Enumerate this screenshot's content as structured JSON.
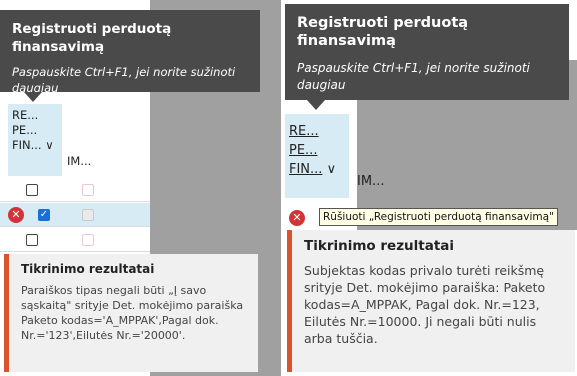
{
  "left_panel": {
    "tooltip_title": "Registruoti perduotą finansavimą",
    "tooltip_hint": "Paspauskite Ctrl+F1, jei norite sužinoti daugiau",
    "column_header_lines": [
      "RE...",
      "PE...",
      "FIN..."
    ],
    "column_header_chevron": "∨",
    "column2_header": "IM...",
    "check_mark": "✓",
    "error_icon_glyph": "✕",
    "result_title": "Tikrinimo rezultatai",
    "result_text": "Paraiškos tipas negali būti „Į savo sąskaitą\" srityje Det. mokėjimo paraiška Paketo kodas='A_MPPAK',Pagal dok. Nr.='123',Eilutės Nr.='20000'."
  },
  "right_panel": {
    "tooltip_title": "Registruoti perduotą finansavimą",
    "tooltip_hint": "Paspauskite Ctrl+F1, jei norite sužinoti daugiau",
    "column_header_lines": [
      "RE...",
      "PE...",
      "FIN..."
    ],
    "column_header_chevron": "∨",
    "column2_header": "IM...",
    "error_icon_glyph": "✕",
    "sort_tooltip": "Rūšiuoti „Registruoti perduotą finansavimą\"",
    "result_title": "Tikrinimo rezultatai",
    "result_text": "Subjektas kodas privalo turėti reikšmę srityje Det. mokėjimo paraiška: Paketo kodas=A_MPPAK, Pagal dok. Nr.=123, Eilutės Nr.=10000. Ji negali būti nulis arba tušči​a."
  },
  "colors": {
    "tooltip_bg": "#4a4a4a",
    "header_highlight": "#d7ebf5",
    "error_red": "#d13438",
    "result_accent": "#d9532d",
    "checkbox_blue": "#1a6fd4"
  }
}
